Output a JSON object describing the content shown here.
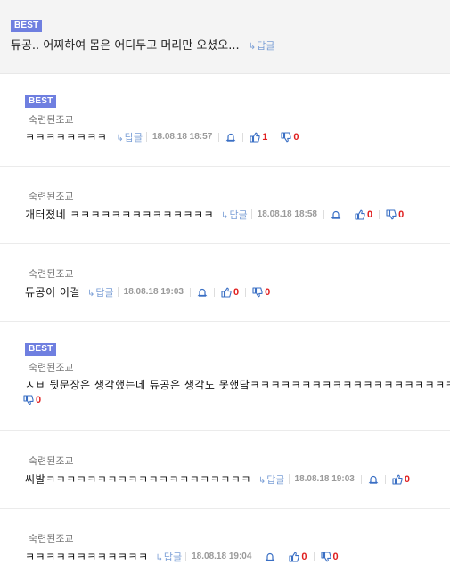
{
  "top_comment": {
    "badge": "BEST",
    "text": "듀공.. 어찌하여 몸은 어디두고 머리만 오셨오...",
    "reply_label": "답글"
  },
  "comments": [
    {
      "badge": "BEST",
      "author": "숙련된조교",
      "text": "ㅋㅋㅋㅋㅋㅋㅋㅋ",
      "reply_label": "답글",
      "date": "18.08.18 18:57",
      "likes": "1",
      "dislikes": "0"
    },
    {
      "badge": "",
      "author": "숙련된조교",
      "text": "개터졌네 ㅋㅋㅋㅋㅋㅋㅋㅋㅋㅋㅋㅋㅋㅋ",
      "reply_label": "답글",
      "date": "18.08.18 18:58",
      "likes": "0",
      "dislikes": "0"
    },
    {
      "badge": "",
      "author": "숙련된조교",
      "text": "듀공이 이걸",
      "reply_label": "답글",
      "date": "18.08.18 19:03",
      "likes": "0",
      "dislikes": "0"
    },
    {
      "badge": "BEST",
      "author": "숙련된조교",
      "text": "ㅅㅂ 뒷문장은 생각했는데 듀공은 생각도 못했닼ㅋㅋㅋㅋㅋㅋㅋㅋㅋㅋㅋㅋㅋㅋㅋㅋㅋㅋㅋㅋ",
      "reply_label": "",
      "date": "",
      "likes": "",
      "dislikes": "0"
    },
    {
      "badge": "",
      "author": "숙련된조교",
      "text": "씨발ㅋㅋㅋㅋㅋㅋㅋㅋㅋㅋㅋㅋㅋㅋㅋㅋㅋㅋㅋㅋ",
      "reply_label": "답글",
      "date": "18.08.18 19:03",
      "likes": "0",
      "dislikes": ""
    },
    {
      "badge": "",
      "author": "숙련된조교",
      "text": "ㅋㅋㅋㅋㅋㅋㅋㅋㅋㅋㅋㅋ",
      "reply_label": "답글",
      "date": "18.08.18 19:04",
      "likes": "0",
      "dislikes": "0"
    }
  ],
  "colors": {
    "badge_bg": "#6f7fe0",
    "reply_link": "#7b9fd6",
    "vote_icon": "#3a6fc4",
    "vote_count": "#e02020"
  },
  "icons": {
    "reply": "reply-arrow-icon",
    "report": "bell-icon",
    "like": "thumbs-up-icon",
    "dislike": "thumbs-down-icon"
  }
}
